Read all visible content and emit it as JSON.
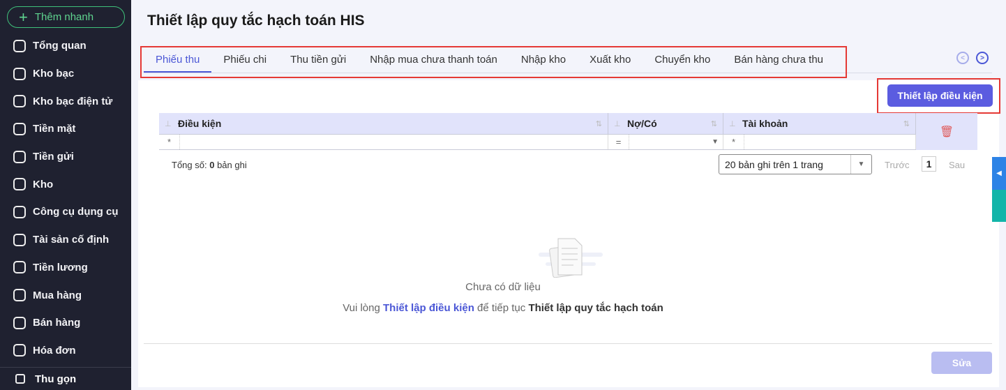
{
  "sidebar": {
    "quick_add": "Thêm nhanh",
    "items": [
      {
        "label": "Tổng quan",
        "icon": "pie-chart-icon"
      },
      {
        "label": "Kho bạc",
        "icon": "treasury-icon"
      },
      {
        "label": "Kho bạc điện tử",
        "icon": "e-treasury-icon"
      },
      {
        "label": "Tiền mặt",
        "icon": "cash-icon"
      },
      {
        "label": "Tiền gửi",
        "icon": "deposit-icon"
      },
      {
        "label": "Kho",
        "icon": "warehouse-icon"
      },
      {
        "label": "Công cụ dụng cụ",
        "icon": "tools-icon"
      },
      {
        "label": "Tài sản cố định",
        "icon": "asset-icon"
      },
      {
        "label": "Tiền lương",
        "icon": "salary-icon"
      },
      {
        "label": "Mua hàng",
        "icon": "cart-icon"
      },
      {
        "label": "Bán hàng",
        "icon": "store-icon"
      },
      {
        "label": "Hóa đơn",
        "icon": "invoice-icon"
      }
    ],
    "collapse": "Thu gọn"
  },
  "page": {
    "title": "Thiết lập quy tắc hạch toán HIS"
  },
  "tabs": [
    "Phiếu thu",
    "Phiếu chi",
    "Thu tiền gửi",
    "Nhập mua chưa thanh toán",
    "Nhập kho",
    "Xuất kho",
    "Chuyển kho",
    "Bán hàng chưa thu"
  ],
  "toolbar": {
    "setup_button": "Thiết lập điều kiện",
    "edit_button": "Sửa"
  },
  "grid": {
    "columns": [
      "Điều kiện",
      "Nợ/Có",
      "Tài khoản"
    ],
    "filters": [
      "*",
      "=",
      "*"
    ]
  },
  "pagination": {
    "total_label": "Tổng số:",
    "total_count": "0",
    "total_suffix": "bản ghi",
    "page_size": "20 bản ghi trên 1 trang",
    "prev": "Trước",
    "page": "1",
    "next": "Sau"
  },
  "empty": {
    "title": "Chưa có dữ liệu",
    "line_prefix": "Vui lòng",
    "link": "Thiết lập điều kiện",
    "line_middle": "để tiếp tục",
    "line_bold": "Thiết lập quy tắc hạch toán"
  }
}
